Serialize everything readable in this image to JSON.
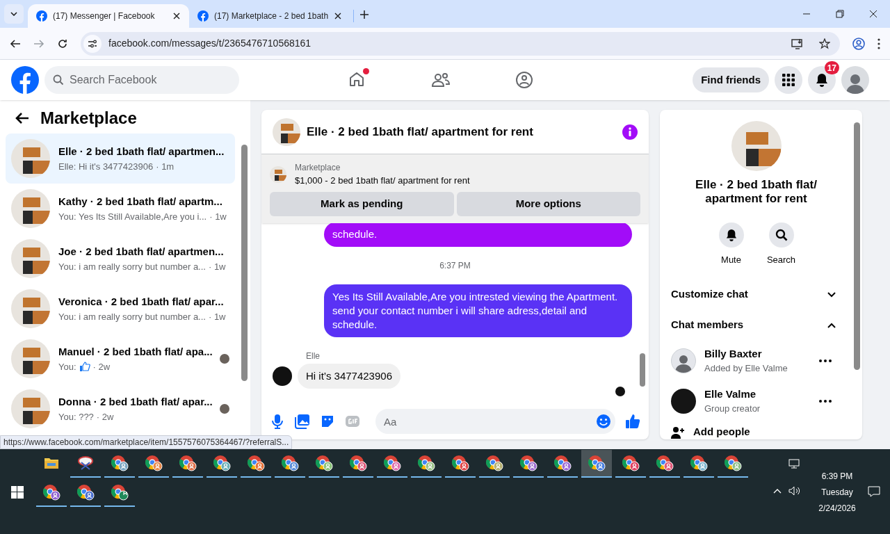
{
  "browser": {
    "tabs": [
      {
        "title": "(17) Messenger | Facebook",
        "selected": true
      },
      {
        "title": "(17) Marketplace - 2 bed 1bath",
        "selected": false
      }
    ],
    "url": "facebook.com/messages/t/2365476710568161"
  },
  "header": {
    "search_placeholder": "Search Facebook",
    "home_badge": true,
    "find_friends": "Find friends",
    "notification_count": "17"
  },
  "sidebar": {
    "title": "Marketplace",
    "conversations": [
      {
        "title": "Elle · 2 bed 1bath flat/ apartmen...",
        "preview": "Elle: Hi it's 3477423906",
        "time": "· 1m",
        "selected": true,
        "like_icon": false,
        "seen": false
      },
      {
        "title": "Kathy · 2 bed 1bath flat/ apartm...",
        "preview": "You: Yes Its Still Available,Are you i...",
        "time": "· 1w",
        "selected": false,
        "like_icon": false,
        "seen": false
      },
      {
        "title": "Joe · 2 bed 1bath flat/ apartmen...",
        "preview": "You: i am really sorry but number a...",
        "time": "· 1w",
        "selected": false,
        "like_icon": false,
        "seen": false
      },
      {
        "title": "Veronica · 2 bed 1bath flat/ apar...",
        "preview": "You: i am really sorry but number a...",
        "time": "· 1w",
        "selected": false,
        "like_icon": false,
        "seen": false
      },
      {
        "title": "Manuel · 2 bed 1bath flat/ apa...",
        "preview": "You:",
        "time": "· 2w",
        "selected": false,
        "like_icon": true,
        "seen": true
      },
      {
        "title": "Donna · 2 bed 1bath flat/ apar...",
        "preview": "You: ???",
        "time": "· 2w",
        "selected": false,
        "like_icon": false,
        "seen": true
      }
    ]
  },
  "chat": {
    "title": "Elle · 2 bed 1bath flat/ apartment for rent",
    "listing": {
      "label": "Marketplace",
      "text": "$1,000 - 2 bed 1bath flat/ apartment for rent"
    },
    "actions": [
      "Mark as pending",
      "More options"
    ],
    "messages": [
      {
        "kind": "outgoing",
        "text": "schedule.",
        "color": "#a20cf8"
      },
      {
        "kind": "timestamp",
        "text": "6:37 PM"
      },
      {
        "kind": "outgoing",
        "text": "Yes Its Still Available,Are you intrested viewing the Apartment. send your contact number i will share adress,detail and schedule.",
        "color": "#5a32f5"
      },
      {
        "kind": "incoming",
        "sender": "Elle",
        "text": "Hi it’s 3477423906"
      }
    ],
    "composer": {
      "placeholder": "Aa"
    }
  },
  "details": {
    "title": "Elle · 2 bed 1bath flat/ apartment for rent",
    "actions": [
      "Mute",
      "Search"
    ],
    "sections": [
      {
        "label": "Customize chat",
        "expanded": false
      },
      {
        "label": "Chat members",
        "expanded": true
      }
    ],
    "members": [
      {
        "name": "Billy Baxter",
        "note": "Added by Elle Valme",
        "kind": "silhouette"
      },
      {
        "name": "Elle Valme",
        "note": "Group creator",
        "kind": "photo"
      }
    ],
    "add_people": "Add people"
  },
  "status_url": "https://www.facebook.com/marketplace/item/1557576075364467/?referralS...",
  "taskbar": {
    "rows": [
      [
        {
          "kind": "folder",
          "selected": false
        },
        {
          "kind": "app",
          "selected": false
        },
        {
          "kind": "chrome",
          "color": "#7aa6c2",
          "selected": false
        },
        {
          "kind": "chrome",
          "color": "#e8894a",
          "selected": false
        },
        {
          "kind": "chrome",
          "color": "#e0714a",
          "selected": false
        },
        {
          "kind": "chrome",
          "color": "#6ab0b8",
          "selected": false
        },
        {
          "kind": "chrome",
          "color": "#e8743a",
          "selected": false
        },
        {
          "kind": "chrome",
          "color": "#5b8dd9",
          "selected": false
        },
        {
          "kind": "chrome",
          "color": "#8bc47a",
          "selected": false
        },
        {
          "kind": "chrome",
          "color": "#e05a7a",
          "selected": false
        },
        {
          "kind": "chrome",
          "color": "#e070b0",
          "selected": false
        },
        {
          "kind": "chrome",
          "color": "#9cc48a",
          "selected": false
        },
        {
          "kind": "chrome",
          "color": "#e04848",
          "selected": false
        },
        {
          "kind": "chrome",
          "color": "#b5b070",
          "selected": false
        },
        {
          "kind": "chrome",
          "color": "#a070d0",
          "selected": false
        },
        {
          "kind": "chrome",
          "color": "#9c6ad8",
          "selected": false
        },
        {
          "kind": "chrome",
          "color": "#4a80e0",
          "selected": true
        },
        {
          "kind": "chrome",
          "color": "#e04060",
          "selected": false
        },
        {
          "kind": "chrome",
          "color": "#e05878",
          "selected": false
        },
        {
          "kind": "chrome",
          "color": "#80b8d0",
          "selected": false
        },
        {
          "kind": "chrome",
          "color": "#8cbf88",
          "selected": false
        }
      ],
      [
        {
          "kind": "chrome",
          "color": "#9060d0",
          "selected": false
        },
        {
          "kind": "chrome",
          "color": "#4a70d0",
          "selected": false
        },
        {
          "kind": "chrome",
          "color": "#1f8a5a",
          "letter": "H",
          "selected": false
        }
      ]
    ],
    "time": "6:39 PM",
    "day": "Tuesday",
    "date": "2/24/2026"
  }
}
